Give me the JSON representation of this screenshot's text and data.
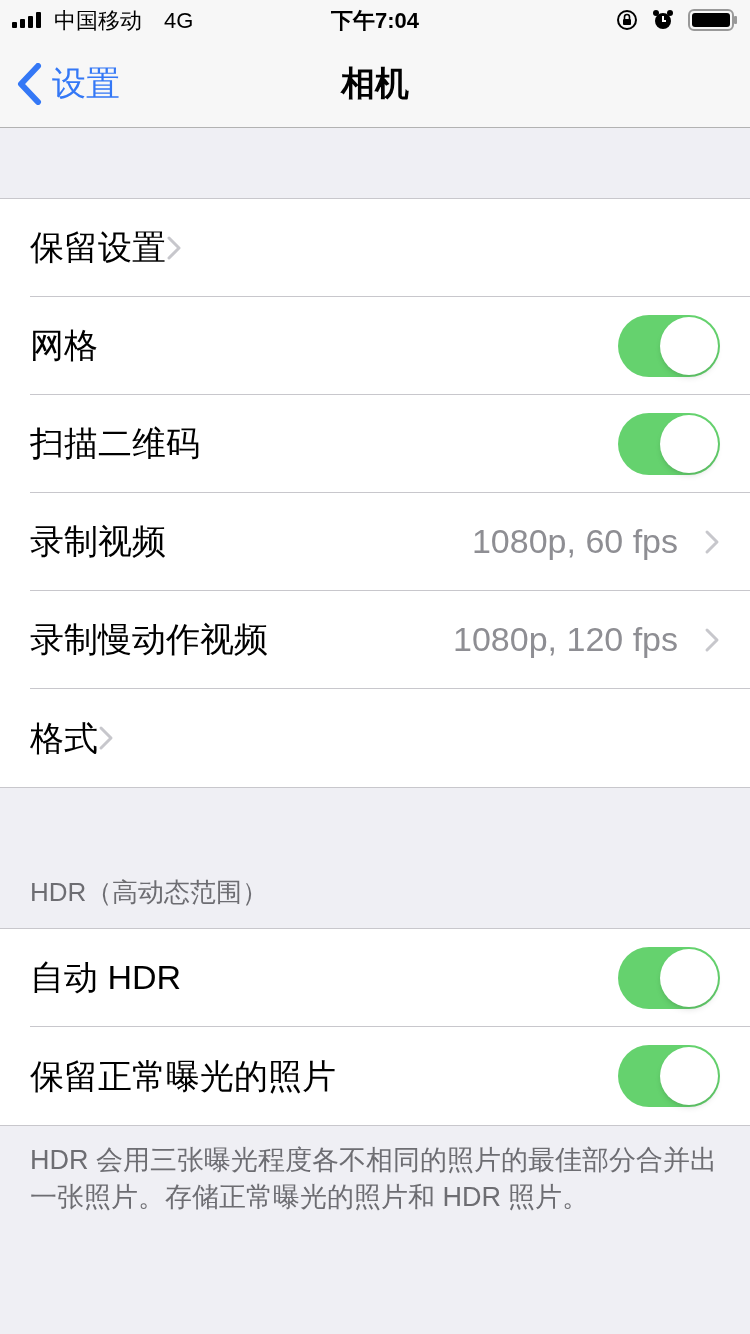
{
  "status_bar": {
    "carrier": "中国移动",
    "network": "4G",
    "time": "下午7:04"
  },
  "nav": {
    "back": "设置",
    "title": "相机"
  },
  "groups": [
    {
      "rows": [
        {
          "kind": "link",
          "label": "保留设置"
        },
        {
          "kind": "toggle",
          "label": "网格",
          "on": true
        },
        {
          "kind": "toggle",
          "label": "扫描二维码",
          "on": true
        },
        {
          "kind": "link",
          "label": "录制视频",
          "value": "1080p, 60 fps"
        },
        {
          "kind": "link",
          "label": "录制慢动作视频",
          "value": "1080p, 120 fps"
        },
        {
          "kind": "link",
          "label": "格式"
        }
      ]
    },
    {
      "header": "HDR（高动态范围）",
      "rows": [
        {
          "kind": "toggle",
          "label": "自动 HDR",
          "on": true
        },
        {
          "kind": "toggle",
          "label": "保留正常曝光的照片",
          "on": true
        }
      ],
      "footer": "HDR 会用三张曝光程度各不相同的照片的最佳部分合并出一张照片。存储正常曝光的照片和 HDR 照片。"
    }
  ]
}
